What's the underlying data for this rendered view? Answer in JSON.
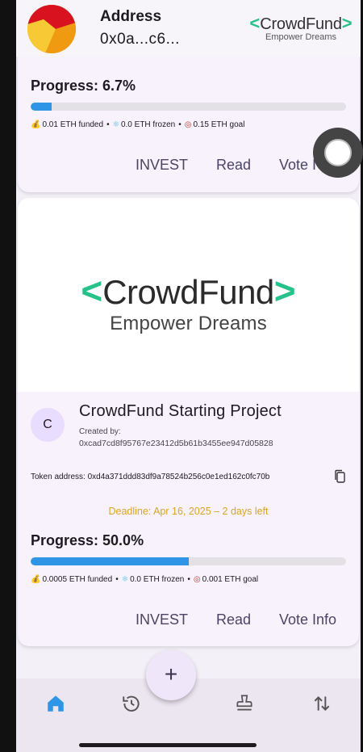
{
  "header": {
    "address_title": "Address",
    "address_value": "0x0a...c6...",
    "logo_word": "CrowdFund",
    "logo_tagline": "Empower Dreams"
  },
  "card1": {
    "progress_label": "Progress: 6.7%",
    "progress_fraction": 0.067,
    "funded": "0.01 ETH funded",
    "frozen": "0.0 ETH frozen",
    "goal": "0.15 ETH goal",
    "actions": {
      "invest": "INVEST",
      "read": "Read",
      "vote": "Vote I"
    }
  },
  "card2": {
    "hero_logo_word": "CrowdFund",
    "hero_tagline": "Empower Dreams",
    "avatar_letter": "C",
    "title": "CrowdFund Starting Project",
    "created_label": "Created by:",
    "creator": "0xcad7cd8f95767e23412d5b61b3455ee947d05828",
    "token_line": "Token address: 0xd4a371ddd83df9a78524b256c0e1ed162c0fc70b",
    "deadline": "Deadline: Apr 16, 2025 – 2 days left",
    "progress_label": "Progress: 50.0%",
    "progress_fraction": 0.5,
    "funded": "0.0005 ETH funded",
    "frozen": "0.0 ETH frozen",
    "goal": "0.001 ETH goal",
    "actions": {
      "invest": "INVEST",
      "read": "Read",
      "vote": "Vote Info"
    }
  },
  "fab_label": "+",
  "colors": {
    "accent": "#2f95e6",
    "brand_green": "#27c18a",
    "deadline": "#e0a520",
    "action_text": "#4b4566"
  },
  "icons": [
    "money-bag-icon",
    "snowflake-icon",
    "target-icon",
    "copy-icon",
    "home-icon",
    "history-icon",
    "stamp-icon",
    "swap-icon",
    "plus-icon"
  ]
}
